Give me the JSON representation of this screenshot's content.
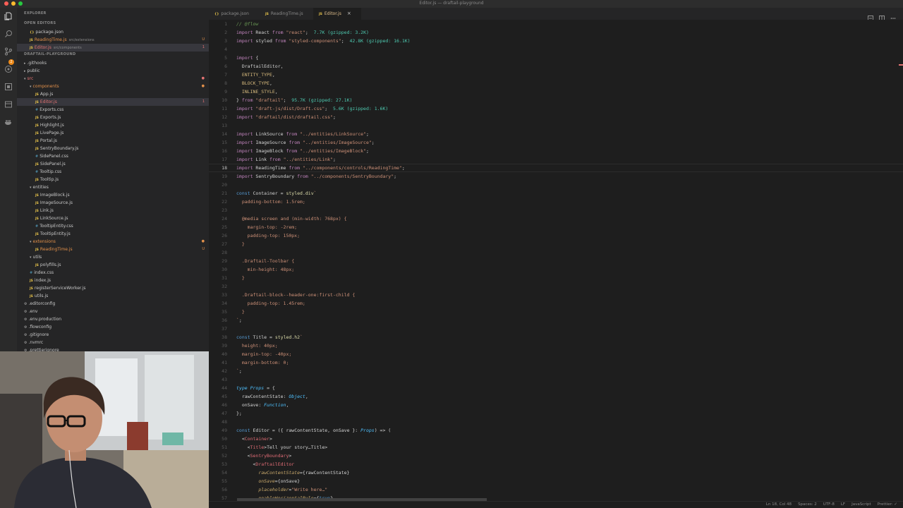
{
  "window": {
    "title": "Editor.js — draftail-playground"
  },
  "colors": {
    "close": "#ff5f57",
    "minimize": "#febc2e",
    "zoom": "#28c840",
    "accent_modified": "#e2904a",
    "error": "#e57373"
  },
  "activity_bar": {
    "icons": [
      "explorer-icon",
      "search-icon",
      "source-control-icon",
      "debug-icon",
      "extensions-icon",
      "remote-icon",
      "docker-icon"
    ],
    "source_control_badge": "2"
  },
  "sidebar": {
    "explorer_label": "EXPLORER",
    "open_editors_label": "OPEN EDITORS",
    "open_editors": [
      {
        "name": "package.json",
        "path": ""
      },
      {
        "name": "ReadingTime.js",
        "path": "src/extensions",
        "mark": "U"
      },
      {
        "name": "Editor.js",
        "path": "src/components",
        "mark": "1"
      }
    ],
    "project_label": "DRAFTAIL-PLAYGROUND",
    "tree": [
      {
        "name": ".githooks",
        "type": "folder"
      },
      {
        "name": "public",
        "type": "folder"
      },
      {
        "name": "src",
        "type": "folder",
        "open": true
      },
      {
        "name": "components",
        "type": "folder",
        "open": true
      },
      {
        "name": "App.js",
        "type": "js"
      },
      {
        "name": "Editor.js",
        "type": "js",
        "mark": "1"
      },
      {
        "name": "Exports.css",
        "type": "css"
      },
      {
        "name": "Exports.js",
        "type": "js"
      },
      {
        "name": "Highlight.js",
        "type": "js"
      },
      {
        "name": "LivePage.js",
        "type": "js"
      },
      {
        "name": "Portal.js",
        "type": "js"
      },
      {
        "name": "SentryBoundary.js",
        "type": "js"
      },
      {
        "name": "SidePanel.css",
        "type": "css"
      },
      {
        "name": "SidePanel.js",
        "type": "js"
      },
      {
        "name": "Tooltip.css",
        "type": "css"
      },
      {
        "name": "Tooltip.js",
        "type": "js"
      },
      {
        "name": "entities",
        "type": "folder",
        "open": true
      },
      {
        "name": "ImageBlock.js",
        "type": "js"
      },
      {
        "name": "ImageSource.js",
        "type": "js"
      },
      {
        "name": "Link.js",
        "type": "js"
      },
      {
        "name": "LinkSource.js",
        "type": "js"
      },
      {
        "name": "TooltipEntity.css",
        "type": "css"
      },
      {
        "name": "TooltipEntity.js",
        "type": "js"
      },
      {
        "name": "extensions",
        "type": "folder",
        "open": true
      },
      {
        "name": "ReadingTime.js",
        "type": "js",
        "mark": "U"
      },
      {
        "name": "utils",
        "type": "folder",
        "open": true
      },
      {
        "name": "polyfills.js",
        "type": "js"
      },
      {
        "name": "index.css",
        "type": "css"
      },
      {
        "name": "index.js",
        "type": "js"
      },
      {
        "name": "registerServiceWorker.js",
        "type": "js"
      },
      {
        "name": "utils.js",
        "type": "js"
      },
      {
        "name": ".editorconfig",
        "type": "config"
      },
      {
        "name": ".env",
        "type": "config"
      },
      {
        "name": ".env.production",
        "type": "config"
      },
      {
        "name": ".flowconfig",
        "type": "config"
      },
      {
        "name": ".gitignore",
        "type": "config"
      },
      {
        "name": ".nvmrc",
        "type": "config"
      },
      {
        "name": ".prettierignore",
        "type": "config"
      }
    ]
  },
  "tabs": [
    {
      "label": "package.json",
      "icon": "{}",
      "active": false
    },
    {
      "label": "ReadingTime.js",
      "icon": "JS",
      "active": false
    },
    {
      "label": "Editor.js",
      "icon": "JS",
      "active": true,
      "close": "×"
    }
  ],
  "editor": {
    "current_line": 18,
    "line_numbers": [
      "1",
      "2",
      "3",
      "4",
      "5",
      "6",
      "7",
      "8",
      "9",
      "10",
      "11",
      "12",
      "13",
      "14",
      "15",
      "16",
      "17",
      "18",
      "19",
      "20",
      "21",
      "22",
      "23",
      "24",
      "25",
      "26",
      "27",
      "28",
      "29",
      "30",
      "31",
      "32",
      "33",
      "34",
      "35",
      "36",
      "37",
      "38",
      "39",
      "40",
      "41",
      "42",
      "43",
      "44",
      "45",
      "46",
      "47",
      "48",
      "49",
      "50",
      "51",
      "52",
      "53",
      "54",
      "55",
      "56",
      "57"
    ]
  },
  "status_bar": {
    "position": "Ln 18, Col 48",
    "spaces": "Spaces: 2",
    "encoding": "UTF-8",
    "eol": "LF",
    "language": "JavaScript",
    "formatter": "Prettier: ✓"
  }
}
